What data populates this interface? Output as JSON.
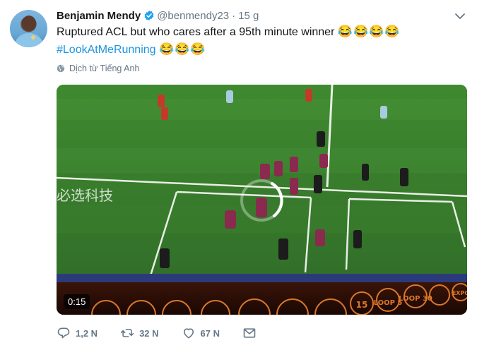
{
  "author": {
    "display_name": "Benjamin Mendy",
    "handle": "@benmendy23",
    "separator": "·",
    "time": "15 g"
  },
  "tweet": {
    "line1_text": "Ruptured ACL but who cares after a 95th minute winner",
    "line1_emoji": "😂😂😂😂",
    "hashtag": "#LookAtMeRunning",
    "line2_emoji": "😂😂😂"
  },
  "translate_label": "Dịch từ Tiếng Anh",
  "media": {
    "duration": "0:15",
    "board_text": "必选科技",
    "controls": [
      "15",
      "LOOP 5",
      "LOOP 30",
      "EXPO"
    ]
  },
  "actions": {
    "replies": "1,2 N",
    "retweets": "32 N",
    "likes": "67 N"
  },
  "colors": {
    "link": "#1b95e0",
    "muted": "#657786",
    "pitch": "#3e7d33",
    "verified": "#1da1f2"
  },
  "icons": [
    "verified-icon",
    "chevron-down-icon",
    "globe-icon",
    "reply-icon",
    "retweet-icon",
    "like-icon",
    "mail-icon"
  ]
}
